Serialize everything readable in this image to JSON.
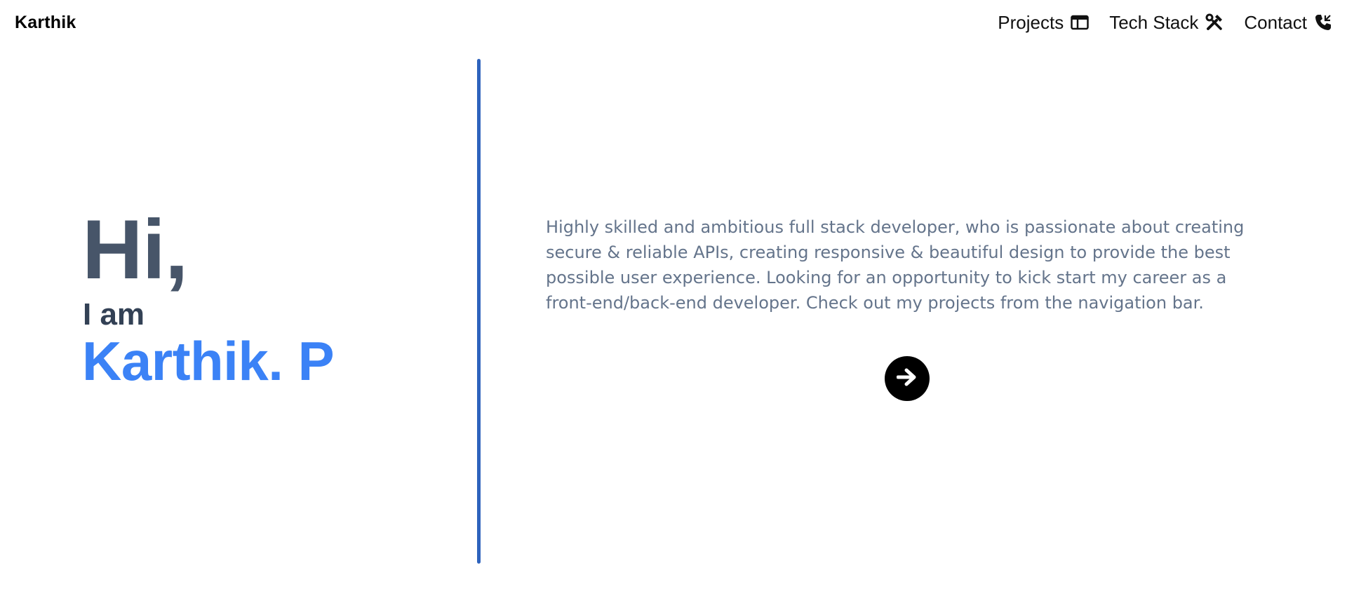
{
  "header": {
    "brand": "Karthik",
    "nav": [
      {
        "label": "Projects",
        "icon": "browser-window-icon"
      },
      {
        "label": "Tech Stack",
        "icon": "tools-icon"
      },
      {
        "label": "Contact",
        "icon": "phone-icon"
      }
    ]
  },
  "hero": {
    "greeting": "Hi,",
    "intro": "I am",
    "name": "Karthik. P"
  },
  "about": {
    "text": "Highly skilled and ambitious full stack developer, who is passionate about creating secure & reliable APIs, creating responsive & beautiful design to provide the best possible user experience. Looking for an opportunity to kick start my career as a front-end/back-end developer. Check out my projects from the navigation bar.",
    "next_icon": "arrow-right-icon"
  },
  "colors": {
    "accent": "#3b82f6",
    "divider": "#2e63bd",
    "heading": "#475569",
    "body_text": "#64748b"
  }
}
